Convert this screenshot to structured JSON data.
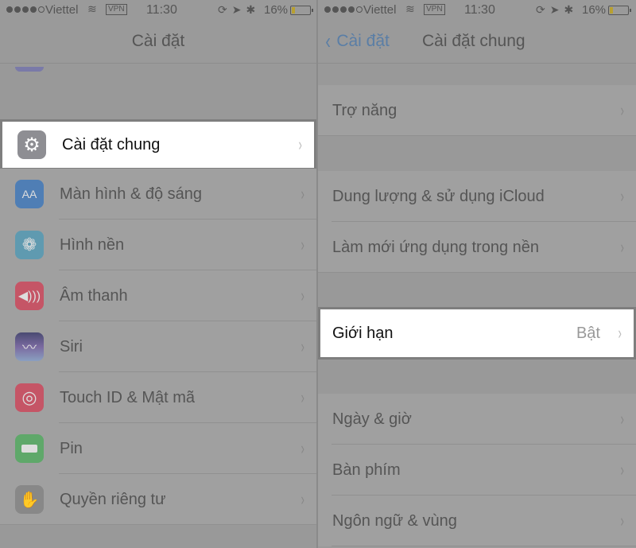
{
  "status_bar": {
    "carrier": "Viettel",
    "vpn": "VPN",
    "time": "11:30",
    "battery_percent": "16%",
    "battery_level": 0.16,
    "signal_bars": 4,
    "icons": [
      "signal-icon",
      "wifi-icon",
      "vpn-icon",
      "rotation-lock-icon",
      "location-icon",
      "bluetooth-icon",
      "battery-icon"
    ]
  },
  "left": {
    "title": "Cài đặt",
    "items": [
      {
        "label": "Cài đặt chung",
        "icon": "gear-icon",
        "color": "#8e8e93",
        "highlighted": true
      },
      {
        "label": "Màn hình & độ sáng",
        "icon": "display-brightness-icon",
        "color": "#4f7eb5"
      },
      {
        "label": "Hình nền",
        "icon": "wallpaper-flower-icon",
        "color": "#5f9ab0"
      },
      {
        "label": "Âm thanh",
        "icon": "speaker-icon",
        "color": "#c55566"
      },
      {
        "label": "Siri",
        "icon": "siri-icon",
        "color": "#4a4a72"
      },
      {
        "label": "Touch ID & Mật mã",
        "icon": "fingerprint-icon",
        "color": "#c55566"
      },
      {
        "label": "Pin",
        "icon": "battery-icon",
        "color": "#5fa86a"
      },
      {
        "label": "Quyền riêng tư",
        "icon": "hand-icon",
        "color": "#888888"
      }
    ]
  },
  "right": {
    "back_label": "Cài đặt",
    "title": "Cài đặt chung",
    "items": [
      {
        "label": "Trợ năng"
      },
      {
        "label": "Dung lượng & sử dụng iCloud"
      },
      {
        "label": "Làm mới ứng dụng trong nền"
      },
      {
        "label": "Giới hạn",
        "detail": "Bật",
        "highlighted": true
      },
      {
        "label": "Ngày & giờ"
      },
      {
        "label": "Bàn phím"
      },
      {
        "label": "Ngôn ngữ & vùng"
      }
    ]
  },
  "glyphs": {
    "chevron": "›",
    "back_chevron": "‹",
    "wifi": "≋",
    "status_icons": "⟳➤✱",
    "aa": "AA",
    "flower": "❁",
    "speaker": "🔊",
    "siri": "〰",
    "fingerprint": "◎",
    "hand": "✋"
  }
}
